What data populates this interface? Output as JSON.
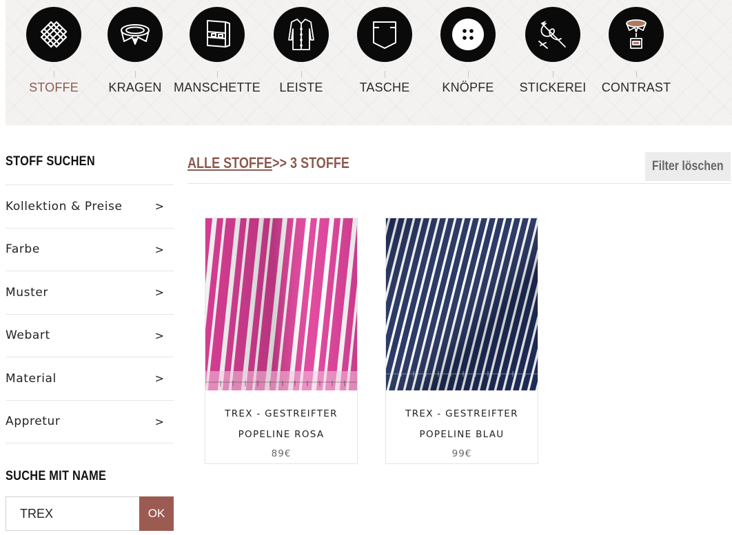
{
  "steps": [
    {
      "label": "STOFFE",
      "icon": "fabric-weave-icon",
      "active": true
    },
    {
      "label": "KRAGEN",
      "icon": "collar-icon",
      "active": false
    },
    {
      "label": "MANSCHETTE",
      "icon": "cuff-icon",
      "active": false
    },
    {
      "label": "LEISTE",
      "icon": "shirt-placket-icon",
      "active": false
    },
    {
      "label": "TASCHE",
      "icon": "pocket-icon",
      "active": false
    },
    {
      "label": "KNÖPFE",
      "icon": "button-icon",
      "active": false
    },
    {
      "label": "STICKEREI",
      "icon": "needle-embroidery-icon",
      "active": false
    },
    {
      "label": "CONTRAST",
      "icon": "contrast-collar-icon",
      "active": false
    }
  ],
  "sidebar": {
    "title": "STOFF SUCHEN",
    "filters": [
      {
        "label": "Kollektion & Preise",
        "arrow": ">"
      },
      {
        "label": "Farbe",
        "arrow": ">"
      },
      {
        "label": "Muster",
        "arrow": ">"
      },
      {
        "label": "Webart",
        "arrow": ">"
      },
      {
        "label": "Material",
        "arrow": ">"
      },
      {
        "label": "Appretur",
        "arrow": ">"
      }
    ],
    "search_title": "SUCHE MIT NAME",
    "search_value": "TREX",
    "search_button": "OK"
  },
  "main": {
    "breadcrumb_link": "ALLE STOFFE",
    "breadcrumb_rest": ">> 3 STOFFE",
    "clear_filter": "Filter löschen",
    "products": [
      {
        "name_line1": "TREX - GESTREIFTER",
        "name_line2": "POPELINE ROSA",
        "price": "89€",
        "swatch_color": "#e0409a",
        "stripe_color": "#ffffff"
      },
      {
        "name_line1": "TREX - GESTREIFTER",
        "name_line2": "POPELINE BLAU",
        "price": "99€",
        "swatch_color": "#1f2f5e",
        "stripe_color": "#ffffff"
      }
    ]
  },
  "colors": {
    "accent": "#8c5a4f",
    "button": "#9b5b52",
    "icon_bg": "#0a0a0a"
  }
}
